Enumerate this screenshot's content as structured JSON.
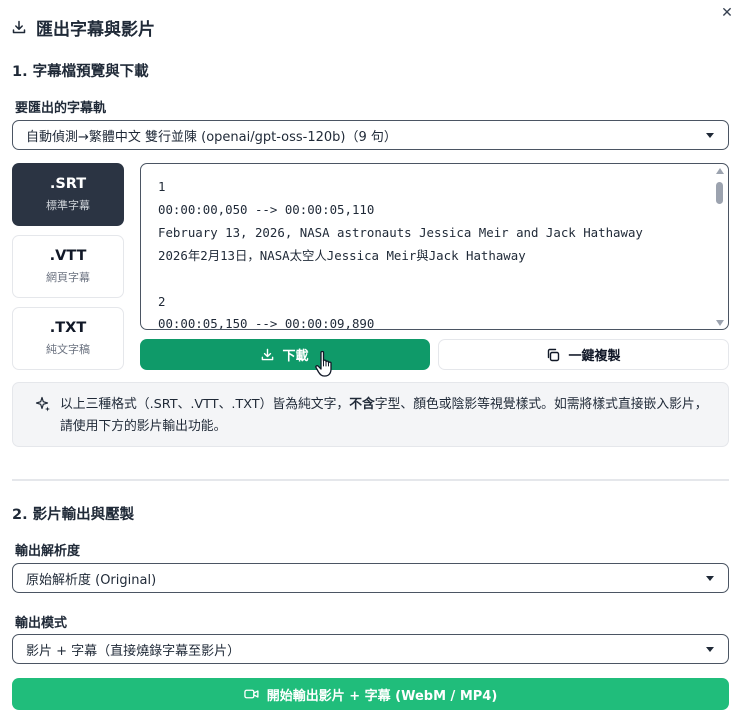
{
  "header": {
    "title": "匯出字幕與影片",
    "icon": "download-icon",
    "close_icon": "close-icon",
    "close_glyph": "✕"
  },
  "section1": {
    "title": "1. 字幕檔預覽與下載",
    "track_label": "要匯出的字幕軌",
    "track_value": "自動偵測→繁體中文 雙行並陳 (openai/gpt-oss-120b)（9 句）",
    "formats": [
      {
        "ext": ".SRT",
        "sub": "標準字幕",
        "active": true
      },
      {
        "ext": ".VTT",
        "sub": "網頁字幕",
        "active": false
      },
      {
        "ext": ".TXT",
        "sub": "純文字稿",
        "active": false
      }
    ],
    "preview_text": "1\n00:00:00,050 --> 00:00:05,110\nFebruary 13, 2026, NASA astronauts Jessica Meir and Jack Hathaway\n2026年2月13日，NASA太空人Jessica Meir與Jack Hathaway\n\n2\n00:00:05,150 --> 00:00:09,890",
    "download_label": "下載",
    "copy_label": "一鍵複製",
    "note_before": "以上三種格式（.SRT、.VTT、.TXT）皆為純文字，",
    "note_bold": "不含",
    "note_after": "字型、顏色或陰影等視覺樣式。如需將樣式直接嵌入影片，請使用下方的影片輸出功能。"
  },
  "section2": {
    "title": "2. 影片輸出與壓製",
    "resolution_label": "輸出解析度",
    "resolution_value": "原始解析度 (Original)",
    "mode_label": "輸出模式",
    "mode_value": "影片 + 字幕（直接燒錄字幕至影片）",
    "export_label": "開始輸出影片 + 字幕 (WebM / MP4)"
  },
  "colors": {
    "primary_green": "#0f9a69",
    "export_green": "#20bd7b",
    "active_tab": "#2b3443"
  }
}
